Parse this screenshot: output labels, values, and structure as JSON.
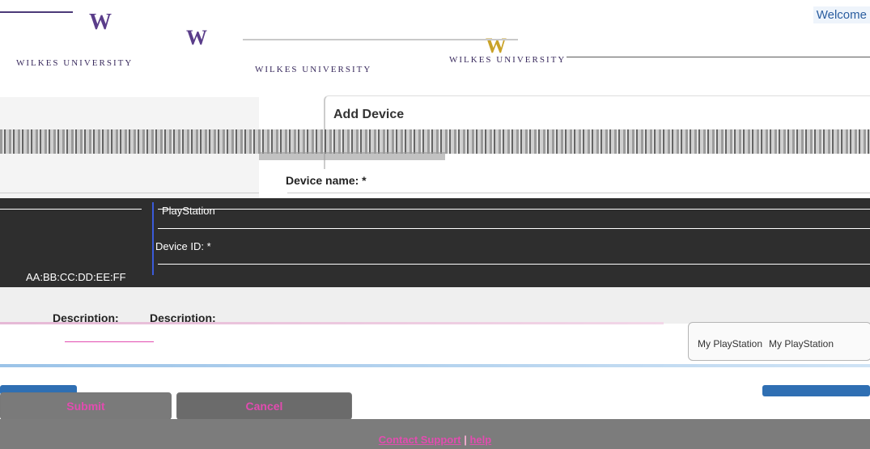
{
  "header": {
    "welcome_text": "Welcome",
    "logo_mark": "W",
    "logo_text": "WILKES UNIVERSITY"
  },
  "card": {
    "title": "Add Device"
  },
  "form": {
    "device_name_label": "Device name: *",
    "device_name_value": "PlayStation",
    "device_id_label": "Device ID: *",
    "device_id_value": "AA:BB:CC:DD:EE:FF",
    "description_label": "Description:",
    "description_label_alt": "Description:",
    "description_value": "My PlayStation",
    "description_value_alt": "My PlayStation"
  },
  "buttons": {
    "submit_label": "Submit",
    "cancel_label": "Cancel"
  },
  "footer": {
    "contact_label": "Contact Support",
    "separator": "|",
    "help_label": "help"
  }
}
